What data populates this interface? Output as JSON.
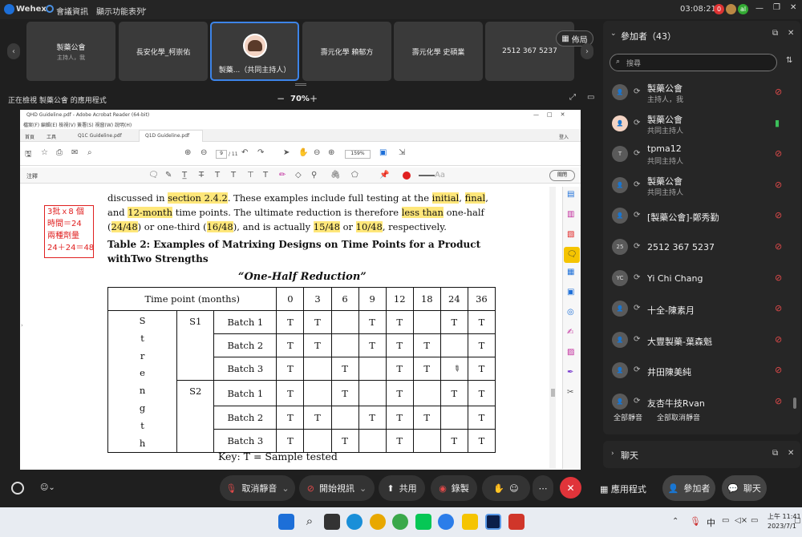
{
  "app": {
    "name": "Wehex",
    "meeting_info": "會議資訊",
    "layout_menu": "顯示功能表列",
    "clock": "03:08:21",
    "badge_red": "0",
    "badge_green": "al"
  },
  "tiles": [
    {
      "name": "製藥公會",
      "sub": "主持人，我"
    },
    {
      "name": "長安化學_柯崇佑",
      "sub": ""
    },
    {
      "name": "製藥...（共同主持人）",
      "sub": ""
    },
    {
      "name": "壽元化學 賴郁方",
      "sub": ""
    },
    {
      "name": "壽元化學 史碩業",
      "sub": ""
    },
    {
      "name": "2512 367 5237",
      "sub": ""
    }
  ],
  "layout_btn": "佈局",
  "share_bar": {
    "text": "正在檢視 製藥公會 的應用程式",
    "zoom": "70%",
    "minus": "−",
    "plus": "+"
  },
  "pdf": {
    "title": "QHD Guideline.pdf - Adobe Acrobat Reader (64-bit)",
    "menu": "檔案(F)  編輯(E)  檢視(V)  簽署(S)  視窗(W)  說明(H)",
    "tabs": [
      "首頁",
      "工具",
      "Q1C Guideline.pdf",
      "Q1D Guideline.pdf"
    ],
    "login": "登入",
    "page_current": "9",
    "page_total": "/ 11",
    "zoom": "159%",
    "comment_label": "注釋",
    "close_label": "關閉",
    "para_line1": "discussed in section 2.4.2. These examples include full testing at the initial, final,",
    "para_line2": "and 12-month time points. The ultimate reduction is therefore less than one-half",
    "para_line3": "(24/48) or one-third (16/48), and is actually 15/48 or 10/48, respectively.",
    "note": [
      "3批ｘ8 個",
      "時間＝24",
      "兩種劑量",
      "24＋24＝48"
    ],
    "table_title": "Table 2:   Examples of Matrixing Designs on Time Points for a Product",
    "table_title2": "withTwo Strengths",
    "subtitle": "“One-Half Reduction”",
    "header_label": "Time point (months)",
    "time_points": [
      "0",
      "3",
      "6",
      "9",
      "12",
      "18",
      "24",
      "36"
    ],
    "strength_letters": [
      "S",
      "t",
      "r",
      "e",
      "n",
      "g",
      "t",
      "h"
    ],
    "groups": [
      "S1",
      "S2"
    ],
    "rows": [
      {
        "batch": "Batch 1",
        "cells": [
          "T",
          "T",
          "",
          "T",
          "T",
          "",
          "T",
          "T"
        ]
      },
      {
        "batch": "Batch 2",
        "cells": [
          "T",
          "T",
          "",
          "T",
          "T",
          "T",
          "",
          "T"
        ]
      },
      {
        "batch": "Batch 3",
        "cells": [
          "T",
          "",
          "T",
          "",
          "T",
          "T",
          "",
          "T"
        ]
      },
      {
        "batch": "Batch 1",
        "cells": [
          "T",
          "",
          "T",
          "",
          "T",
          "",
          "T",
          "T"
        ]
      },
      {
        "batch": "Batch 2",
        "cells": [
          "T",
          "T",
          "",
          "T",
          "T",
          "T",
          "",
          "T"
        ]
      },
      {
        "batch": "Batch 3",
        "cells": [
          "T",
          "",
          "T",
          "",
          "T",
          "",
          "T",
          "T"
        ]
      }
    ],
    "key": "Key: T = Sample tested"
  },
  "panel": {
    "title": "參加者（43）",
    "search_placeholder": "搜尋",
    "participants": [
      {
        "avatar": "",
        "name": "製藥公會",
        "role": "主持人，我",
        "mic": "muted"
      },
      {
        "avatar": "",
        "name": "製藥公會",
        "role": "共同主持人",
        "mic": "on"
      },
      {
        "avatar": "T",
        "name": "tpma12",
        "role": "共同主持人",
        "mic": "muted"
      },
      {
        "avatar": "",
        "name": "製藥公會",
        "role": "共同主持人",
        "mic": "muted"
      },
      {
        "avatar": "",
        "name": "[製藥公會]-鄭秀勤",
        "role": "",
        "mic": "muted"
      },
      {
        "avatar": "25",
        "name": "2512 367 5237",
        "role": "",
        "mic": "muted"
      },
      {
        "avatar": "YC",
        "name": "Yi Chi Chang",
        "role": "",
        "mic": "muted"
      },
      {
        "avatar": "",
        "name": "十全-陳素月",
        "role": "",
        "mic": "muted"
      },
      {
        "avatar": "",
        "name": "大豐製藥-葉森魁",
        "role": "",
        "mic": "muted"
      },
      {
        "avatar": "",
        "name": "井田陳美純",
        "role": "",
        "mic": "muted"
      },
      {
        "avatar": "",
        "name": "友杏牛技Rvan",
        "role": "",
        "mic": "muted"
      }
    ],
    "mute_all": "全部靜音",
    "unmute_all": "全部取消靜音",
    "chat": "聊天"
  },
  "bottom": {
    "unmute": "取消靜音",
    "video": "開始視訊",
    "share": "共用",
    "record": "錄製",
    "apps": "應用程式",
    "participants": "參加者",
    "chat": "聊天"
  },
  "taskbar": {
    "time": "上午 11:41",
    "date": "2023/7/1",
    "ime": "中"
  }
}
